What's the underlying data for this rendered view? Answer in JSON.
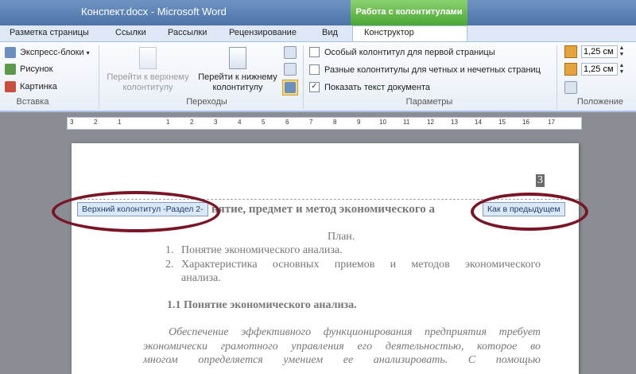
{
  "window": {
    "title": "Конспект.docx - Microsoft Word",
    "context_tab_header": "Работа с колонтитулами"
  },
  "tabs": [
    {
      "label": "Разметка страницы"
    },
    {
      "label": "Ссылки"
    },
    {
      "label": "Рассылки"
    },
    {
      "label": "Рецензирование"
    },
    {
      "label": "Вид"
    },
    {
      "label": "Конструктор"
    }
  ],
  "ribbon": {
    "insert_group": {
      "items": [
        {
          "label": "Экспресс-блоки"
        },
        {
          "label": "Рисунок"
        },
        {
          "label": "Картинка"
        }
      ],
      "label": "Вставка"
    },
    "nav_group": {
      "prev": "Перейти к верхнему колонтитулу",
      "next": "Перейти к нижнему колонтитулу",
      "label": "Переходы"
    },
    "params_group": {
      "options": [
        {
          "label": "Особый колонтитул для первой страницы",
          "checked": false
        },
        {
          "label": "Разные колонтитулы для четных и нечетных страниц",
          "checked": false
        },
        {
          "label": "Показать текст документа",
          "checked": true
        }
      ],
      "label": "Параметры"
    },
    "position_group": {
      "header_from_top": "1,25 см",
      "footer_from_bottom": "1,25 см",
      "label": "Положение"
    }
  },
  "ruler": {
    "numbers": [
      "3",
      "2",
      "1",
      "1",
      "2",
      "3",
      "4",
      "5",
      "6",
      "7",
      "8",
      "9",
      "10",
      "11",
      "12",
      "13",
      "14",
      "15",
      "16",
      "17"
    ]
  },
  "document": {
    "page_number": "3",
    "header_tag": "Верхний колонтитул -Раздел 2-",
    "same_as_previous": "Как в предыдущем",
    "title": "нятие, предмет и метод экономического а",
    "plan": "План.",
    "list": [
      {
        "num": "1.",
        "text": "Понятие экономического анализа."
      },
      {
        "num": "2.",
        "text": "Характеристика основных приемов и методов экономического"
      },
      {
        "num": "",
        "text": "анализа."
      }
    ],
    "section_heading": "1.1  Понятие экономического анализа.",
    "para_lines": [
      "Обеспечение эффективного функционирования предприятия требует",
      "экономически грамотного управления его деятельностью, которое во",
      "многом определяется умением ее анализировать. С помощью"
    ]
  },
  "colors": {
    "accent": "#7a1525",
    "context_tab": "#4aa633"
  }
}
